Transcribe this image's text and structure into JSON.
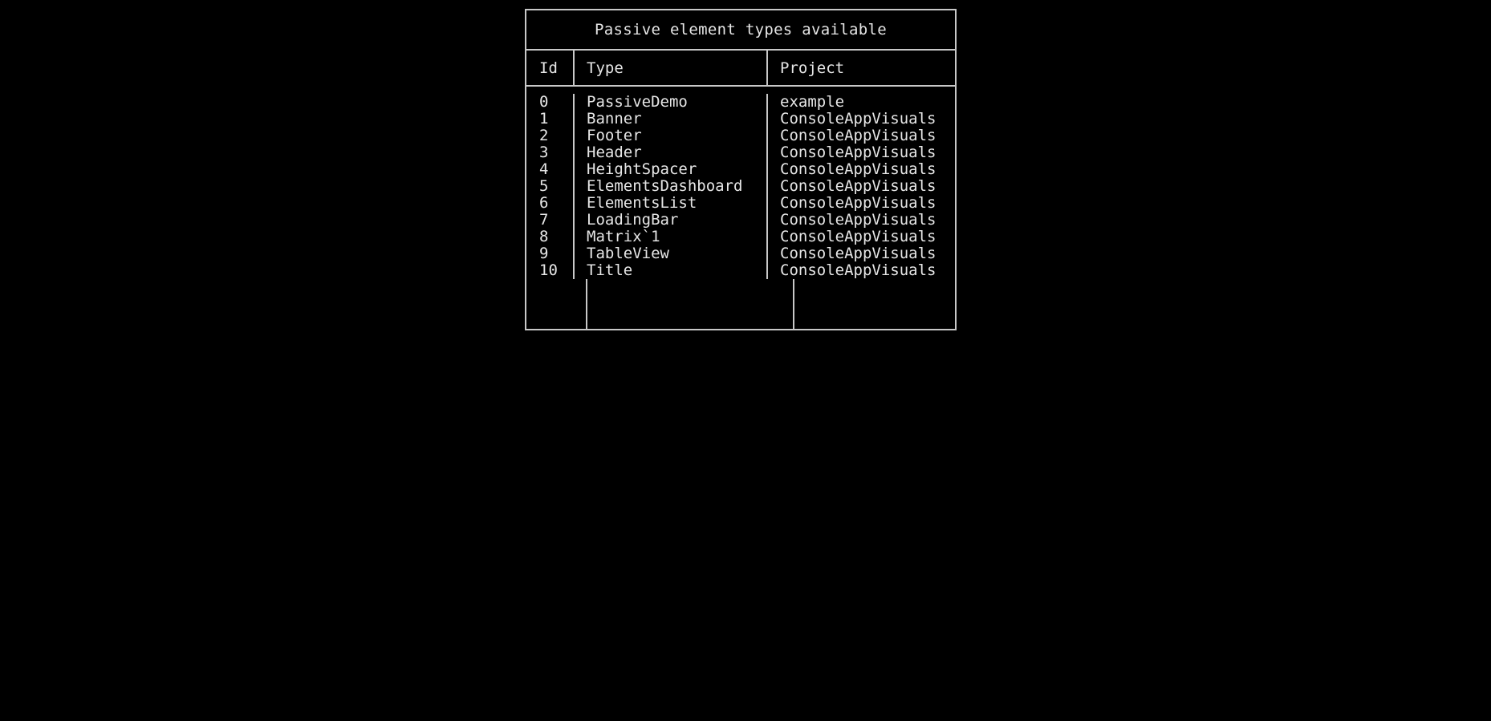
{
  "screen": {
    "background": "#000000",
    "foreground": "#e6e6e6",
    "border_color": "#c8c8c8"
  },
  "table": {
    "title": "Passive element types available",
    "columns": [
      "Id",
      "Type",
      "Project"
    ],
    "rows": [
      {
        "id": "0",
        "type": "PassiveDemo",
        "project": "example"
      },
      {
        "id": "1",
        "type": "Banner",
        "project": "ConsoleAppVisuals"
      },
      {
        "id": "2",
        "type": "Footer",
        "project": "ConsoleAppVisuals"
      },
      {
        "id": "3",
        "type": "Header",
        "project": "ConsoleAppVisuals"
      },
      {
        "id": "4",
        "type": "HeightSpacer",
        "project": "ConsoleAppVisuals"
      },
      {
        "id": "5",
        "type": "ElementsDashboard",
        "project": "ConsoleAppVisuals"
      },
      {
        "id": "6",
        "type": "ElementsList",
        "project": "ConsoleAppVisuals"
      },
      {
        "id": "7",
        "type": "LoadingBar",
        "project": "ConsoleAppVisuals"
      },
      {
        "id": "8",
        "type": "Matrix`1",
        "project": "ConsoleAppVisuals"
      },
      {
        "id": "9",
        "type": "TableView",
        "project": "ConsoleAppVisuals"
      },
      {
        "id": "10",
        "type": "Title",
        "project": "ConsoleAppVisuals"
      }
    ]
  }
}
